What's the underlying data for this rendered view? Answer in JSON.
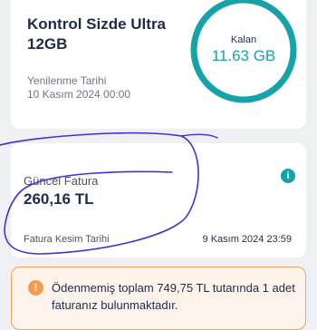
{
  "package": {
    "name": "Kontrol Sizde Ultra 12GB",
    "renewal_label": "Yenilenme Tarihi",
    "renewal_date": "10 Kasım 2024 00:00",
    "remaining_label": "Kalan",
    "remaining_value": "11.63 GB",
    "ring_color": "#14a3a8"
  },
  "invoice": {
    "label": "Güncel Fatura",
    "amount": "260,16 TL",
    "cut_label": "Fatura Kesim Tarihi",
    "cut_date": "9 Kasım 2024 23:59",
    "info_icon": "info-icon"
  },
  "warning": {
    "icon": "warning-icon",
    "text": "Ödenmemiş toplam 749,75 TL tutarında 1 adet faturanız bulunmaktadır.",
    "accent": "#f39c4a"
  }
}
